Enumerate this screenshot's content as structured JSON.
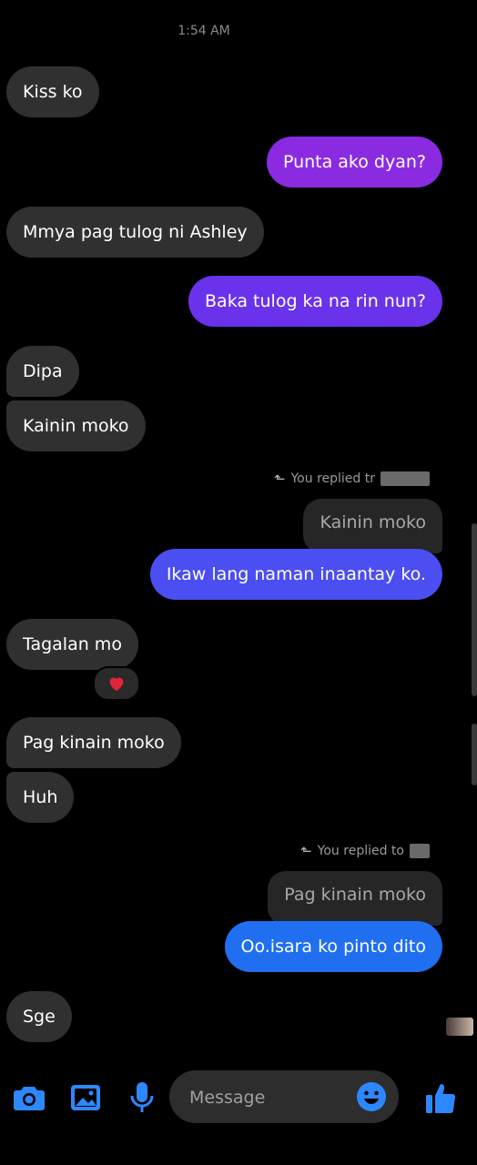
{
  "timestamp": "1:54 AM",
  "messages": [
    {
      "text": "Kiss ko"
    },
    {
      "text": "Punta ako dyan?"
    },
    {
      "text": "Mmya pag tulog ni Ashley"
    },
    {
      "text": "Baka tulog ka na rin nun?"
    },
    {
      "text": "Dipa"
    },
    {
      "text": "Kainin moko"
    },
    {
      "text": "Ikaw lang naman inaantay ko."
    },
    {
      "text": "Tagalan mo"
    },
    {
      "text": "Pag kinain moko"
    },
    {
      "text": "Huh"
    },
    {
      "text": "Oo.isara ko pinto dito"
    },
    {
      "text": "Sge"
    }
  ],
  "replies": [
    {
      "note": "You replied tr",
      "quoted": "Kainin moko"
    },
    {
      "note": "You replied to",
      "quoted": "Pag kinain moko"
    }
  ],
  "reaction": {
    "emoji": "heart",
    "color": "#e0243a"
  },
  "composer": {
    "placeholder": "Message"
  },
  "colors": {
    "incoming_bubble": "#303030",
    "outgoing_purple": "#8a2be2",
    "outgoing_violet": "#6a32ea",
    "outgoing_indigo": "#4b4ef0",
    "outgoing_blue": "#1f6ff0",
    "icon_blue": "#2d88ff",
    "background": "#000000"
  }
}
